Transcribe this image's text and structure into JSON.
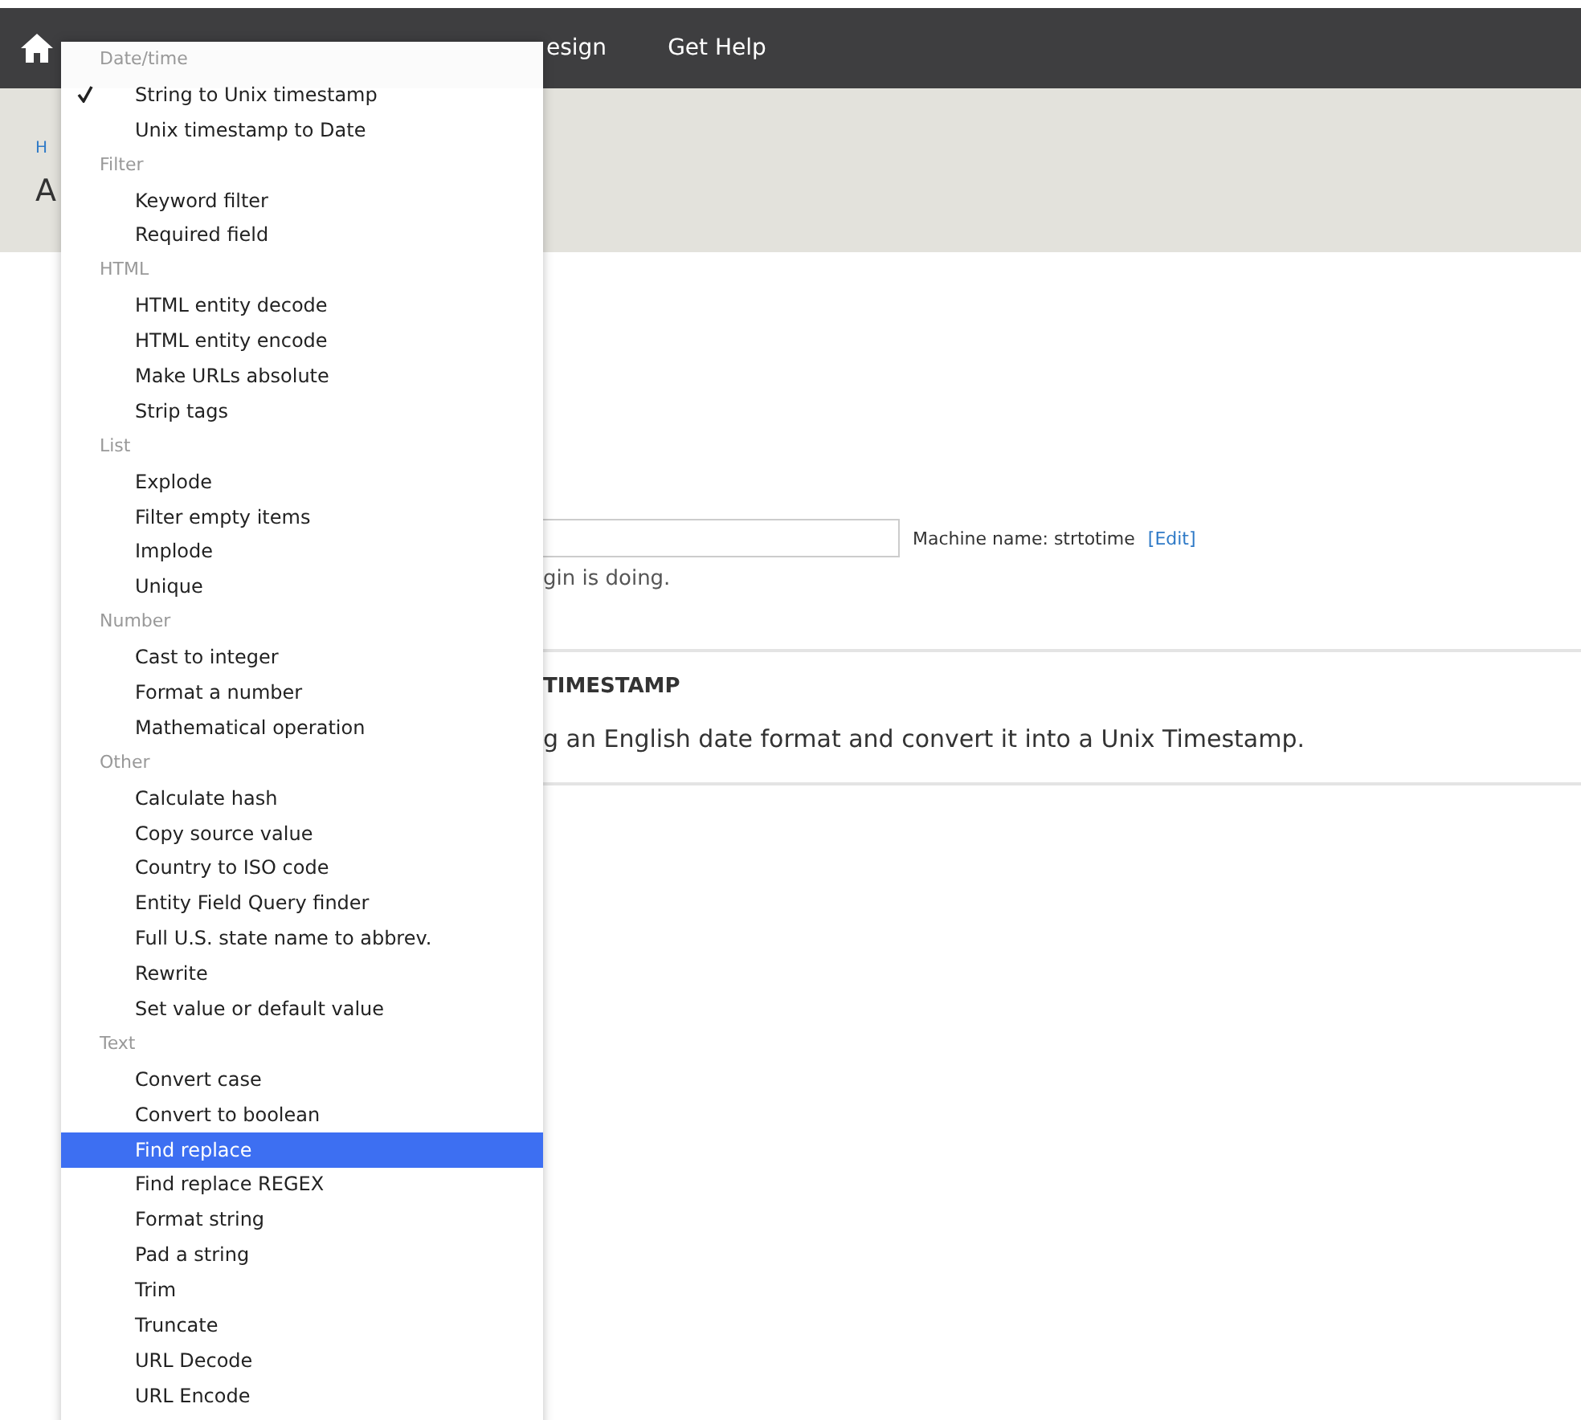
{
  "top_bar": {
    "items": [
      {
        "label": "esign"
      },
      {
        "label": "Get Help"
      }
    ]
  },
  "header": {
    "breadcrumb": "H",
    "title": "A"
  },
  "form": {
    "machine_name": "Machine name: strtotime",
    "edit_link": "[Edit]",
    "help": "gin is doing."
  },
  "plugin": {
    "title": "TIMESTAMP",
    "description": "g an English date format and convert it into a Unix Timestamp."
  },
  "menu": {
    "groups": [
      {
        "label": "Date/time",
        "items": [
          {
            "label": "String to Unix timestamp",
            "checked": true,
            "selected": false
          },
          {
            "label": "Unix timestamp to Date",
            "checked": false,
            "selected": false
          }
        ]
      },
      {
        "label": "Filter",
        "items": [
          {
            "label": "Keyword filter",
            "checked": false,
            "selected": false
          },
          {
            "label": "Required field",
            "checked": false,
            "selected": false
          }
        ]
      },
      {
        "label": "HTML",
        "items": [
          {
            "label": "HTML entity decode",
            "checked": false,
            "selected": false
          },
          {
            "label": "HTML entity encode",
            "checked": false,
            "selected": false
          },
          {
            "label": "Make URLs absolute",
            "checked": false,
            "selected": false
          },
          {
            "label": "Strip tags",
            "checked": false,
            "selected": false
          }
        ]
      },
      {
        "label": "List",
        "items": [
          {
            "label": "Explode",
            "checked": false,
            "selected": false
          },
          {
            "label": "Filter empty items",
            "checked": false,
            "selected": false
          },
          {
            "label": "Implode",
            "checked": false,
            "selected": false
          },
          {
            "label": "Unique",
            "checked": false,
            "selected": false
          }
        ]
      },
      {
        "label": "Number",
        "items": [
          {
            "label": "Cast to integer",
            "checked": false,
            "selected": false
          },
          {
            "label": "Format a number",
            "checked": false,
            "selected": false
          },
          {
            "label": "Mathematical operation",
            "checked": false,
            "selected": false
          }
        ]
      },
      {
        "label": "Other",
        "items": [
          {
            "label": "Calculate hash",
            "checked": false,
            "selected": false
          },
          {
            "label": "Copy source value",
            "checked": false,
            "selected": false
          },
          {
            "label": "Country to ISO code",
            "checked": false,
            "selected": false
          },
          {
            "label": "Entity Field Query finder",
            "checked": false,
            "selected": false
          },
          {
            "label": "Full U.S. state name to abbrev.",
            "checked": false,
            "selected": false
          },
          {
            "label": "Rewrite",
            "checked": false,
            "selected": false
          },
          {
            "label": "Set value or default value",
            "checked": false,
            "selected": false
          }
        ]
      },
      {
        "label": "Text",
        "items": [
          {
            "label": "Convert case",
            "checked": false,
            "selected": false
          },
          {
            "label": "Convert to boolean",
            "checked": false,
            "selected": false
          },
          {
            "label": "Find replace",
            "checked": false,
            "selected": true
          },
          {
            "label": "Find replace REGEX",
            "checked": false,
            "selected": false
          },
          {
            "label": "Format string",
            "checked": false,
            "selected": false
          },
          {
            "label": "Pad a string",
            "checked": false,
            "selected": false
          },
          {
            "label": "Trim",
            "checked": false,
            "selected": false
          },
          {
            "label": "Truncate",
            "checked": false,
            "selected": false
          },
          {
            "label": "URL Decode",
            "checked": false,
            "selected": false
          },
          {
            "label": "URL Encode",
            "checked": false,
            "selected": false
          }
        ]
      }
    ]
  }
}
